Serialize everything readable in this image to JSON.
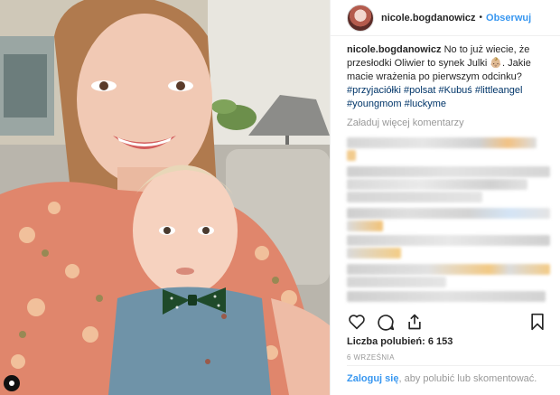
{
  "post": {
    "username": "nicole.bogdanowicz",
    "separator": "•",
    "follow_label": "Obserwuj",
    "caption_user": "nicole.bogdanowicz",
    "caption_text": " No to już wiecie, że przesłodki Oliwier to synek Julki 👶🏼. Jakie macie wrażenia po pierwszym odcinku?",
    "hashtags": "#przyjaciółki #polsat #Kubuś #littleangel #youngmom #luckyme",
    "load_more": "Załaduj więcej komentarzy",
    "likes_label": "Liczba polubień:",
    "likes_count": "6 153",
    "date": "6 WRZEŚNIA",
    "login_link": "Zaloguj się",
    "login_text": ", aby polubić lub skomentować."
  },
  "icons": {
    "like": "heart-icon",
    "comment": "comment-icon",
    "share": "share-icon",
    "save": "bookmark-icon"
  },
  "colors": {
    "accent": "#3897f0",
    "hashtag": "#003569",
    "muted": "#999999",
    "text": "#262626"
  }
}
